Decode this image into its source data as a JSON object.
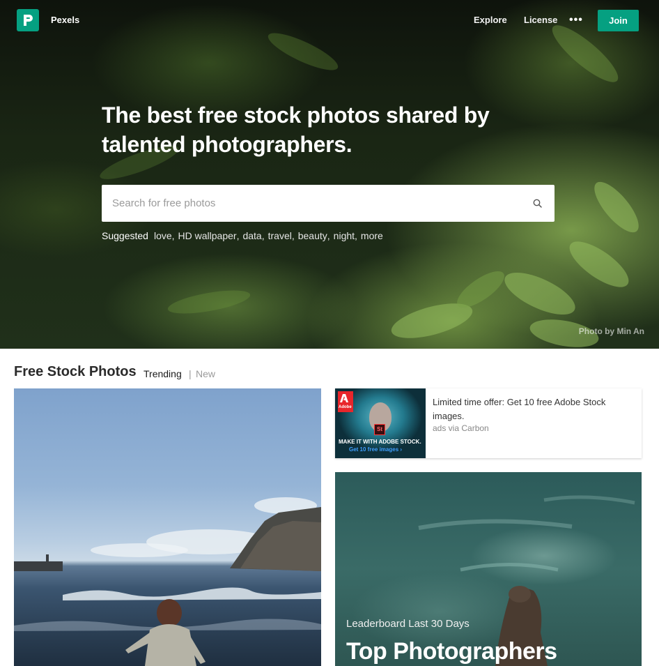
{
  "header": {
    "brand": "Pexels",
    "nav": {
      "explore": "Explore",
      "license": "License",
      "more": "•••"
    },
    "join_label": "Join"
  },
  "hero": {
    "headline": "The best free stock photos shared by talented photographers.",
    "search": {
      "placeholder": "Search for free photos",
      "value": ""
    },
    "suggested_label": "Suggested",
    "suggested_tags": [
      "love",
      "HD wallpaper",
      "data",
      "travel",
      "beauty",
      "night",
      "more"
    ],
    "credit": "Photo by Min An"
  },
  "section": {
    "title": "Free Stock Photos",
    "tabs": {
      "trending": "Trending",
      "separator": "|",
      "new": "New"
    }
  },
  "ad": {
    "text": "Limited time offer: Get 10 free Adobe Stock images.",
    "via": "ads via Carbon",
    "image_brand": "Adobe",
    "image_badge": "St",
    "image_headline": "MAKE IT WITH ADOBE STOCK.",
    "image_cta": "Get 10 free images ›"
  },
  "leaderboard": {
    "subtitle": "Leaderboard Last 30 Days",
    "title": "Top Photographers"
  },
  "colors": {
    "brand_green": "#05a081",
    "adobe_red": "#e8262b",
    "text_dark": "#1a1a1a",
    "text_muted": "#9a9a9a"
  },
  "icons": {
    "logo": "pexels-logo-icon",
    "search": "search-icon",
    "more": "more-dots-icon"
  }
}
